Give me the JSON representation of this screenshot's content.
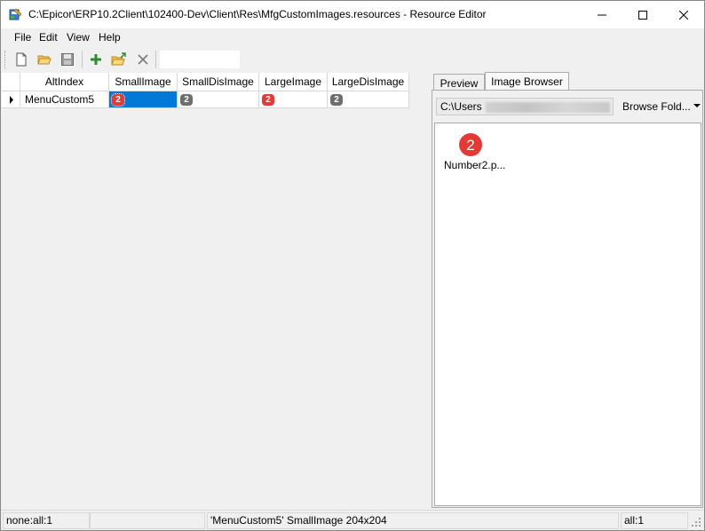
{
  "window": {
    "title": "C:\\Epicor\\ERP10.2Client\\102400-Dev\\Client\\Res\\MfgCustomImages.resources - Resource Editor"
  },
  "menu": {
    "items": [
      "File",
      "Edit",
      "View",
      "Help"
    ]
  },
  "toolbar": {
    "icons": [
      "new-file-icon",
      "open-folder-icon",
      "save-icon",
      "add-icon",
      "import-folder-icon",
      "delete-icon"
    ],
    "text_field_value": ""
  },
  "grid": {
    "columns": [
      "AltIndex",
      "SmallImage",
      "SmallDisImage",
      "LargeImage",
      "LargeDisImage"
    ],
    "rows": [
      {
        "alt_index": "MenuCustom5",
        "small_image_badge": "2",
        "small_dis_image_badge": "2",
        "large_image_badge": "2",
        "large_dis_image_badge": "2"
      }
    ]
  },
  "right_panel": {
    "tabs": [
      "Preview",
      "Image Browser"
    ],
    "active_tab": "Image Browser",
    "path_prefix": "C:\\Users",
    "browse_button": "Browse Fold...",
    "images": [
      {
        "badge": "2",
        "label": "Number2.p..."
      }
    ]
  },
  "status": {
    "left": "none:all:1",
    "middle": "'MenuCustom5' SmallImage 204x204",
    "right": "all:1"
  },
  "colors": {
    "badge_red": "#e53935",
    "badge_gray": "#6e6e6e",
    "selection": "#0078d7"
  }
}
